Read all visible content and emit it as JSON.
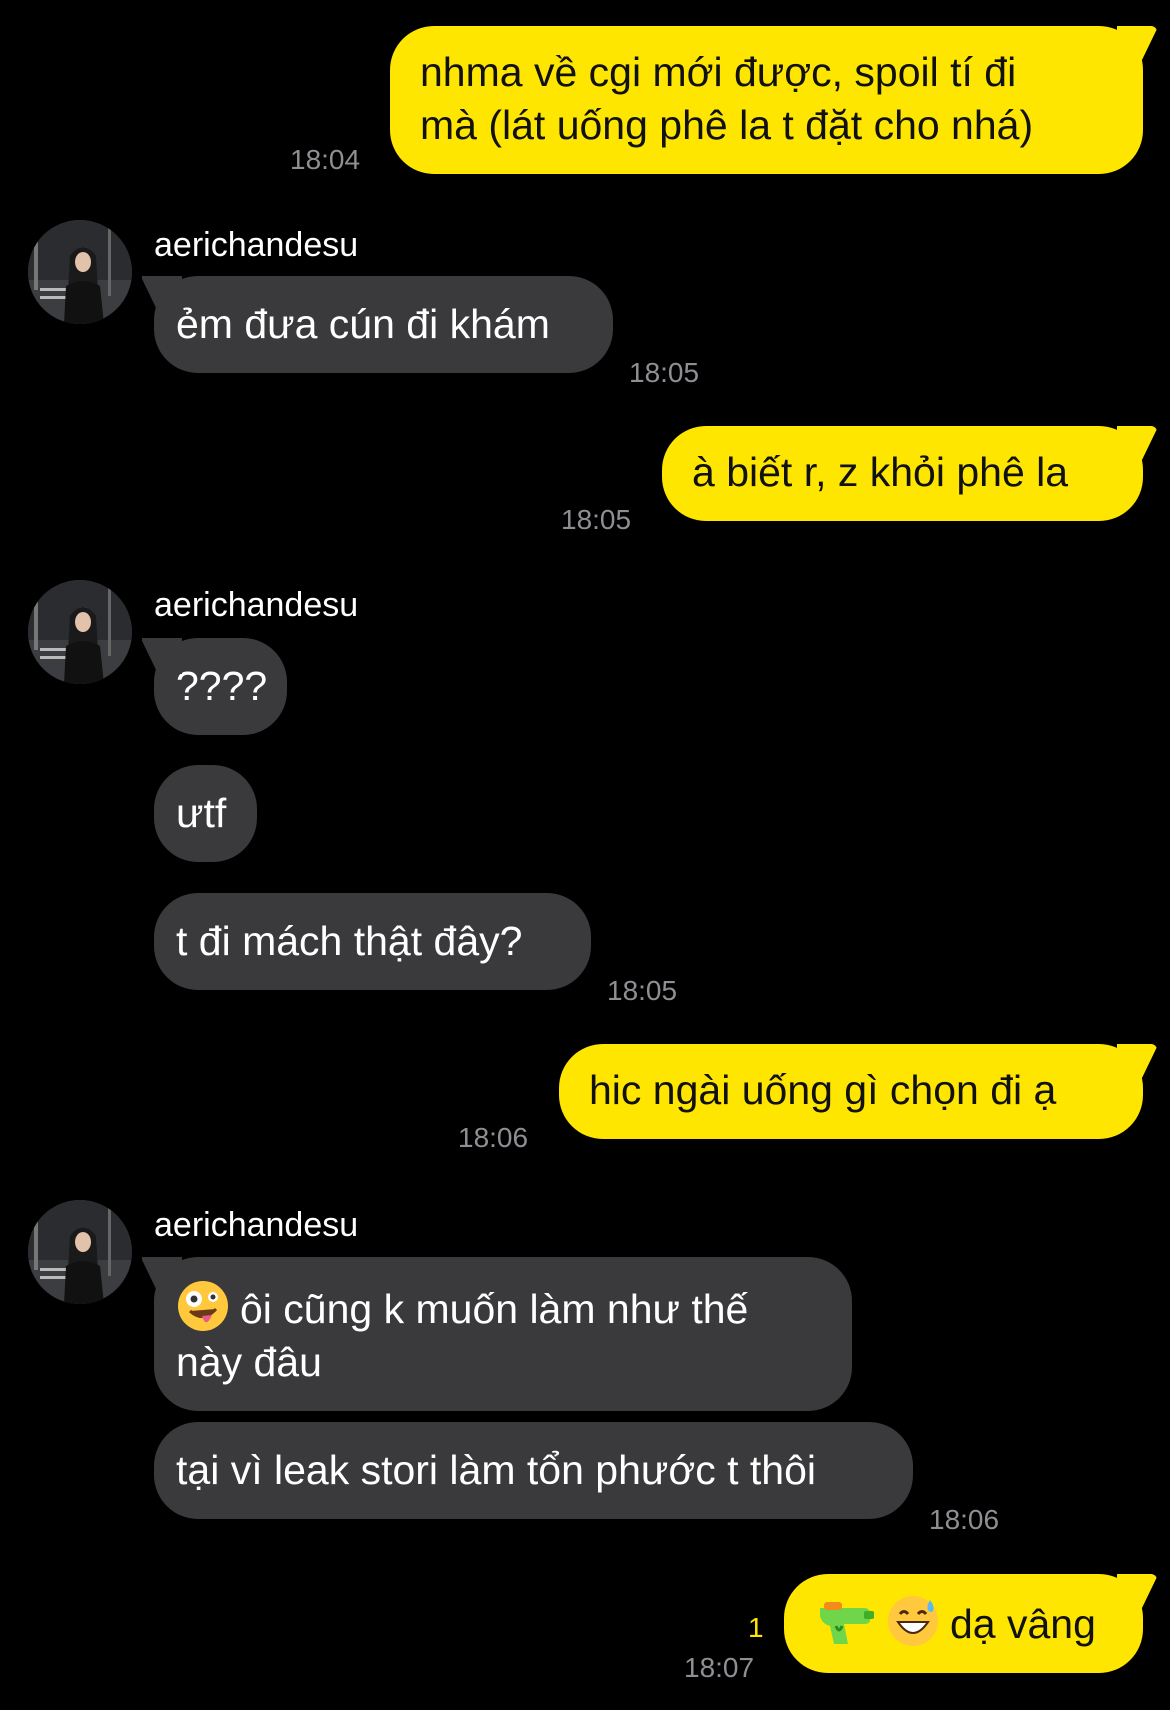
{
  "contact": {
    "name": "aerichandesu"
  },
  "messages": [
    {
      "from": "me",
      "lines": [
        "nhma về cgi mới được, spoil tí đi",
        "mà (lát uống phê la t đặt cho nhá)"
      ],
      "time": "18:04"
    },
    {
      "from": "them",
      "text": "ẻm đưa cún đi khám",
      "time": "18:05"
    },
    {
      "from": "me",
      "text": "à biết r, z khỏi phê la",
      "time": "18:05"
    },
    {
      "from": "them",
      "text": "????"
    },
    {
      "from": "them",
      "text": "ưtf"
    },
    {
      "from": "them",
      "text": "t đi mách thật đây?",
      "time": "18:05"
    },
    {
      "from": "me",
      "text": "hic ngài uống gì chọn đi ạ",
      "time": "18:06"
    },
    {
      "from": "them",
      "lines": [
        "ôi cũng k muốn làm như thế",
        "này đâu"
      ],
      "emoji": "zany-face-icon"
    },
    {
      "from": "them",
      "text": "tại vì leak stori làm tổn phước t thôi",
      "time": "18:06"
    },
    {
      "from": "me",
      "text": "dạ vâng",
      "emojis": [
        "water-pistol-icon",
        "grinning-sweat-icon"
      ],
      "time": "18:07",
      "unread_count": "1"
    }
  ],
  "colors": {
    "outgoing": "#FFE600",
    "incoming": "#3A3A3C",
    "background": "#000000",
    "timestamp": "#8E8E93"
  }
}
